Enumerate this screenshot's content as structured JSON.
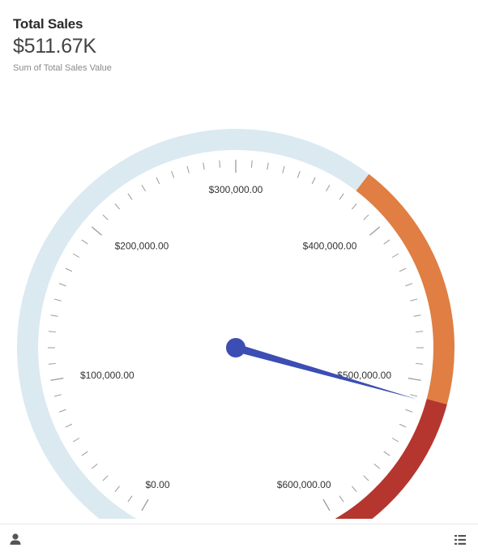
{
  "header": {
    "title": "Total Sales",
    "value": "$511.67K",
    "subtitle": "Sum of Total Sales Value"
  },
  "chart_data": {
    "type": "gauge",
    "value": 511670,
    "min": 0,
    "max": 600000,
    "tick_labels": [
      {
        "value": 0,
        "label": "$0.00"
      },
      {
        "value": 100000,
        "label": "$100,000.00"
      },
      {
        "value": 200000,
        "label": "$200,000.00"
      },
      {
        "value": 300000,
        "label": "$300,000.00"
      },
      {
        "value": 400000,
        "label": "$400,000.00"
      },
      {
        "value": 500000,
        "label": "$500,000.00"
      },
      {
        "value": 600000,
        "label": "$600,000.00"
      }
    ],
    "bands": [
      {
        "from": 0,
        "to": 375000,
        "color": "#dbe9f1"
      },
      {
        "from": 375000,
        "to": 510000,
        "color": "#e07e43"
      },
      {
        "from": 510000,
        "to": 600000,
        "color": "#b5362f"
      }
    ],
    "needle_color": "#3c4db3"
  },
  "footer": {
    "left_icon": "user-icon",
    "right_icon": "list-icon"
  }
}
